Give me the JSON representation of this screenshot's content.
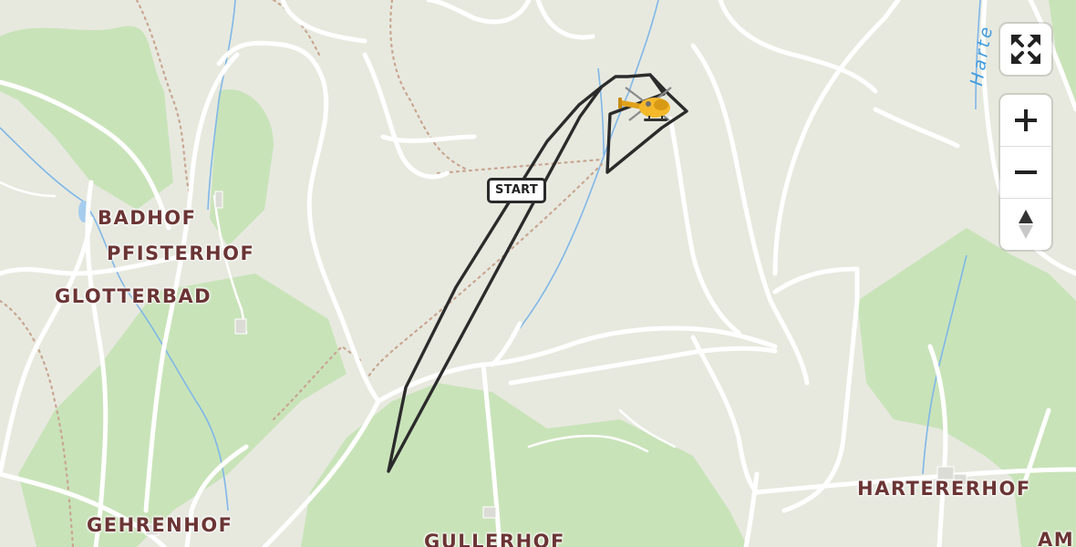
{
  "map": {
    "place_labels": [
      {
        "id": "badhof",
        "text": "BADHOF"
      },
      {
        "id": "pfisterhof",
        "text": "PFISTERHOF"
      },
      {
        "id": "glotterbad",
        "text": "GLOTTERBAD"
      },
      {
        "id": "gehrenhof",
        "text": "GEHRENHOF"
      },
      {
        "id": "gullerhof",
        "text": "GULLERHOF"
      },
      {
        "id": "harterhof",
        "text": "HARTERERHOF"
      },
      {
        "id": "am",
        "text": "AM"
      }
    ],
    "water_label": "Harte",
    "route": {
      "start_label": "START",
      "marker_icon": "helicopter-icon"
    },
    "colors": {
      "background": "#e7e9df",
      "forest": "#c9e3b9",
      "road": "#ffffff",
      "river": "#7fb7e8",
      "route": "#2b2b2b",
      "label": "#6b3434"
    }
  },
  "controls": {
    "fullscreen": {
      "icon": "fullscreen-icon",
      "label": "Fullscreen"
    },
    "zoom_in": {
      "icon": "plus-icon",
      "label": "+"
    },
    "zoom_out": {
      "icon": "minus-icon",
      "label": "−"
    },
    "compass": {
      "icon": "compass-icon",
      "label": "Reset bearing"
    }
  }
}
